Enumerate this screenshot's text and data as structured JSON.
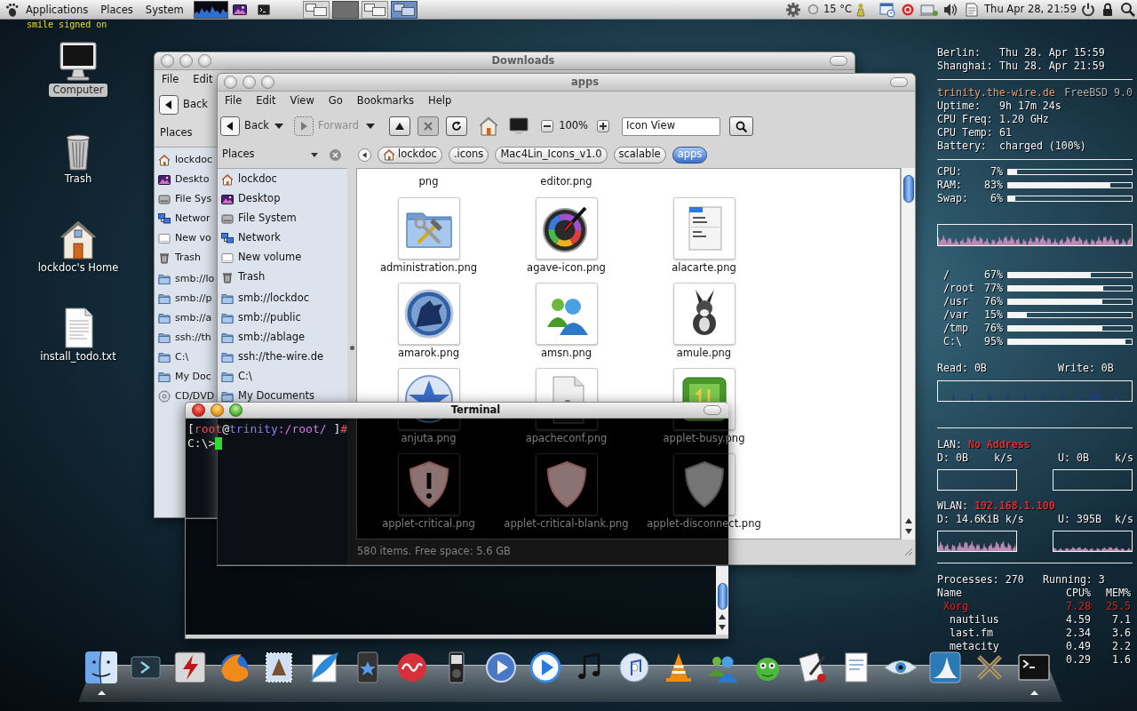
{
  "top_panel": {
    "menus": [
      "Applications",
      "Places",
      "System"
    ],
    "workspaces": [
      {
        "selected": false,
        "kind": "windows"
      },
      {
        "selected": false,
        "kind": "maximized"
      },
      {
        "selected": false,
        "kind": "windows"
      },
      {
        "selected": true,
        "kind": "windows"
      }
    ],
    "temperature": "15 °C",
    "clock": "Thu Apr 28, 21:59"
  },
  "notification": "smile signed on",
  "desktop_icons": [
    {
      "label": "Computer",
      "kind": "computer",
      "selected": true
    },
    {
      "label": "Trash",
      "kind": "trash",
      "selected": false
    },
    {
      "label": "lockdoc's Home",
      "kind": "home",
      "selected": false
    },
    {
      "label": "install_todo.txt",
      "kind": "document",
      "selected": false
    }
  ],
  "downloads_window": {
    "title": "Downloads",
    "active": false,
    "menus": [
      "File",
      "Edit"
    ],
    "back": {
      "label": "Back",
      "disabled": false
    },
    "sidebar": {
      "header": "Places",
      "devices": [
        {
          "label": "lockdoc",
          "kind": "home"
        },
        {
          "label": "Deskto",
          "kind": "desktop"
        },
        {
          "label": "File Sys",
          "kind": "drive"
        },
        {
          "label": "Networ",
          "kind": "network"
        },
        {
          "label": "New vo",
          "kind": "volume"
        },
        {
          "label": "Trash",
          "kind": "trash"
        }
      ],
      "bookmarks": [
        {
          "label": "smb://lo",
          "kind": "folder"
        },
        {
          "label": "smb://p",
          "kind": "folder"
        },
        {
          "label": "smb://a",
          "kind": "folder"
        },
        {
          "label": "ssh://th",
          "kind": "folder"
        },
        {
          "label": "C:\\",
          "kind": "folder"
        },
        {
          "label": "My Doc",
          "kind": "folder"
        },
        {
          "label": "CD/DVD",
          "kind": "disc"
        }
      ]
    }
  },
  "apps_window": {
    "title": "apps",
    "active": false,
    "menus": [
      "File",
      "Edit",
      "View",
      "Go",
      "Bookmarks",
      "Help"
    ],
    "toolbar": {
      "back": {
        "label": "Back",
        "disabled": false
      },
      "forward": {
        "label": "Forward",
        "disabled": true
      },
      "up": {
        "disabled": false
      },
      "stop": {
        "disabled": true
      },
      "zoom": "100%",
      "view": "Icon View"
    },
    "sidebar": {
      "header": "Places",
      "devices": [
        {
          "label": "lockdoc",
          "kind": "home"
        },
        {
          "label": "Desktop",
          "kind": "desktop"
        },
        {
          "label": "File System",
          "kind": "drive"
        },
        {
          "label": "Network",
          "kind": "network"
        },
        {
          "label": "New volume",
          "kind": "volume"
        },
        {
          "label": "Trash",
          "kind": "trash"
        }
      ],
      "bookmarks": [
        {
          "label": "smb://lockdoc",
          "kind": "folder"
        },
        {
          "label": "smb://public",
          "kind": "folder"
        },
        {
          "label": "smb://ablage",
          "kind": "folder"
        },
        {
          "label": "ssh://the-wire.de",
          "kind": "folder"
        },
        {
          "label": "C:\\",
          "kind": "folder"
        },
        {
          "label": "My Documents",
          "kind": "folder"
        }
      ]
    },
    "path": [
      {
        "label": "lockdoc",
        "kind": "home",
        "selected": false
      },
      {
        "label": ".icons",
        "kind": "folder",
        "selected": false
      },
      {
        "label": "Mac4Lin_Icons_v1.0",
        "kind": "folder",
        "selected": false
      },
      {
        "label": "scalable",
        "kind": "folder",
        "selected": false
      },
      {
        "label": "apps",
        "kind": "folder",
        "selected": true
      }
    ],
    "scrolled_labels": [
      "png",
      "editor.png"
    ],
    "files": [
      {
        "label": "administration.png"
      },
      {
        "label": "agave-icon.png"
      },
      {
        "label": "alacarte.png"
      },
      {
        "label": "amarok.png"
      },
      {
        "label": "amsn.png"
      },
      {
        "label": "amule.png"
      },
      {
        "label": "anjuta.png"
      },
      {
        "label": "apacheconf.png"
      },
      {
        "label": "applet-busy.png"
      },
      {
        "label": "applet-critical.png"
      },
      {
        "label": "applet-critical-blank.png"
      },
      {
        "label": "applet-disconnect.png"
      }
    ],
    "status": "580 items. Free space: 5.6 GB"
  },
  "terminal": {
    "title": "Terminal",
    "active": true,
    "prompt": [
      {
        "text": "[",
        "kind": "plain"
      },
      {
        "text": "root",
        "kind": "user"
      },
      {
        "text": "@",
        "kind": "plain"
      },
      {
        "text": "trinity",
        "kind": "host"
      },
      {
        "text": ":/root/",
        "kind": "path"
      },
      {
        "text": " ]",
        "kind": "plain"
      },
      {
        "text": "#",
        "kind": "user"
      }
    ],
    "input": "C:\\>"
  },
  "conky": {
    "clocks": [
      {
        "city": "Berlin:",
        "time": "Thu 28. Apr 15:59"
      },
      {
        "city": "Shanghai:",
        "time": "Thu 28. Apr 21:59"
      }
    ],
    "host": "trinity.the-wire.de",
    "os": "FreeBSD 9.0",
    "info": [
      {
        "label": "Uptime:",
        "value": "9h 17m 24s"
      },
      {
        "label": "CPU Freq:",
        "value": "1.20 GHz"
      },
      {
        "label": "CPU Temp:",
        "value": "61"
      },
      {
        "label": "Battery:",
        "value": "charged (100%)"
      }
    ],
    "usage": [
      {
        "label": "CPU:",
        "percent": "7%",
        "level": 0.07
      },
      {
        "label": "RAM:",
        "percent": "83%",
        "level": 0.83
      },
      {
        "label": "Swap:",
        "percent": "6%",
        "level": 0.06
      }
    ],
    "filesystems": [
      {
        "label": "/",
        "percent": "67%",
        "level": 0.67
      },
      {
        "label": "/root",
        "percent": "77%",
        "level": 0.77
      },
      {
        "label": "/usr",
        "percent": "76%",
        "level": 0.76
      },
      {
        "label": "/var",
        "percent": "15%",
        "level": 0.15
      },
      {
        "label": "/tmp",
        "percent": "76%",
        "level": 0.76
      },
      {
        "label": "C:\\",
        "percent": "95%",
        "level": 0.95
      }
    ],
    "disk_io": {
      "read": "Read: 0B",
      "write": "Write: 0B"
    },
    "interfaces": [
      {
        "label": "LAN:",
        "address": "No Address",
        "down": "D: 0B",
        "down_unit": "k/s",
        "up": "U: 0B",
        "up_unit": "k/s"
      },
      {
        "label": "WLAN:",
        "address": "192.168.1.100",
        "down": "D: 14.6KiB",
        "down_unit": "k/s",
        "up": "U: 395B",
        "up_unit": "k/s"
      }
    ],
    "processes": {
      "total": "Processes: 270",
      "running": "Running: 3",
      "columns": [
        "Name",
        "CPU%",
        "MEM%"
      ],
      "rows": [
        {
          "name": "Xorg",
          "cpu": "7.28",
          "mem": "25.5",
          "kind": "top"
        },
        {
          "name": "nautilus",
          "cpu": "4.59",
          "mem": "7.1",
          "kind": "normal"
        },
        {
          "name": "last.fm",
          "cpu": "2.34",
          "mem": "3.6",
          "kind": "normal"
        },
        {
          "name": "metacity",
          "cpu": "0.49",
          "mem": "2.2",
          "kind": "normal"
        },
        {
          "cpu": "0.29",
          "mem": "1.6",
          "kind": "normal"
        }
      ]
    }
  },
  "dock": {
    "items": [
      {
        "running": true
      },
      {
        "running": false
      },
      {
        "running": false
      },
      {
        "running": false
      },
      {
        "running": false
      },
      {
        "running": false
      },
      {
        "running": false
      },
      {
        "running": false
      },
      {
        "running": false
      },
      {
        "running": false
      },
      {
        "running": false
      },
      {
        "running": false
      },
      {
        "running": false
      },
      {
        "running": false
      },
      {
        "running": false
      },
      {
        "running": false
      },
      {
        "running": false
      },
      {
        "running": false
      },
      {
        "running": false
      },
      {
        "running": false
      },
      {
        "running": false
      },
      {
        "running": true
      }
    ]
  }
}
